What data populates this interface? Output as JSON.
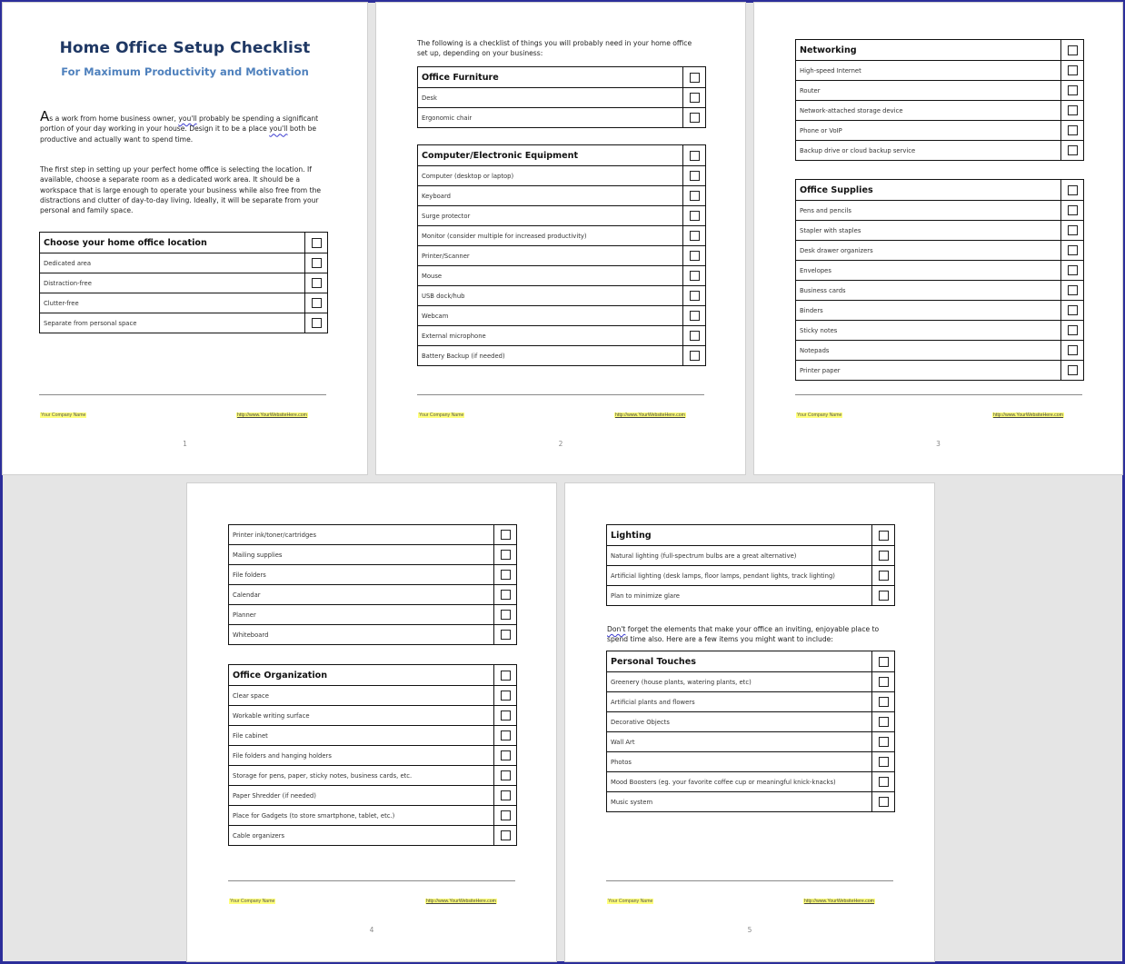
{
  "document": {
    "title": "Home Office Setup Checklist",
    "subtitle": "For Maximum Productivity and Motivation",
    "footer": {
      "company": "Your Company Name",
      "url": "http://www.YourWebsiteHere.com"
    }
  },
  "pages": [
    {
      "number": "1",
      "intro": {
        "dropcap": "A",
        "p1_a": "s a work from home business owner, ",
        "p1_spell1": "you'll",
        "p1_b": " probably be spending a significant portion of your day working in your house. Design it to be a place ",
        "p1_spell2": "you'll",
        "p1_c": " both be productive and actually want to spend time.",
        "p2": "The first step in setting up your perfect home office is selecting the location. If available, choose a separate room as a dedicated work area. It should be a workspace that is large enough to operate your business while also free from the distractions and clutter of day-to-day living. Ideally, it will be separate from your personal and family space."
      },
      "sections": [
        {
          "heading": "Choose your home office location",
          "items": [
            "Dedicated area",
            "Distraction-free",
            "Clutter-free",
            "Separate from personal space"
          ]
        }
      ]
    },
    {
      "number": "2",
      "intro": "The following is a checklist of things you will probably need in your home office set up, depending on your business:",
      "sections": [
        {
          "heading": "Office Furniture",
          "items": [
            "Desk",
            "Ergonomic chair"
          ]
        },
        {
          "heading": "Computer/Electronic Equipment",
          "items": [
            "Computer (desktop or laptop)",
            "Keyboard",
            "Surge protector",
            "Monitor (consider multiple for increased productivity)",
            "Printer/Scanner",
            "Mouse",
            "USB dock/hub",
            "Webcam",
            "External microphone",
            "Battery Backup (if needed)"
          ]
        }
      ]
    },
    {
      "number": "3",
      "sections": [
        {
          "heading": "Networking",
          "items": [
            "High-speed Internet",
            "Router",
            "Network-attached storage device",
            "Phone or VoIP",
            "Backup drive or cloud backup service"
          ]
        },
        {
          "heading": "Office Supplies",
          "items": [
            "Pens and pencils",
            "Stapler with staples",
            "Desk drawer organizers",
            "Envelopes",
            "Business cards",
            "Binders",
            "Sticky notes",
            "Notepads",
            "Printer paper"
          ]
        }
      ]
    },
    {
      "number": "4",
      "sections": [
        {
          "heading": "",
          "items": [
            "Printer ink/toner/cartridges",
            "Mailing supplies",
            "File folders",
            "Calendar",
            "Planner",
            "Whiteboard"
          ]
        },
        {
          "heading": "Office Organization",
          "items": [
            "Clear space",
            "Workable writing surface",
            "File cabinet",
            "File folders and hanging holders",
            "Storage for pens, paper, sticky notes, business cards, etc.",
            "Paper Shredder (if needed)",
            "Place for Gadgets (to store smartphone, tablet, etc.)",
            "Cable organizers"
          ]
        }
      ]
    },
    {
      "number": "5",
      "intro_spell": "Don't",
      "intro": " forget the elements that make your office an inviting, enjoyable place to spend time also. Here are a few items you might want to include:",
      "sections": [
        {
          "heading": "Lighting",
          "items": [
            "Natural lighting (full-spectrum bulbs are a great alternative)",
            "Artificial lighting (desk lamps, floor lamps, pendant lights, track lighting)",
            "Plan to minimize glare"
          ]
        },
        {
          "heading": "Personal Touches",
          "items": [
            "Greenery (house plants, watering plants, etc)",
            "Artificial plants and flowers",
            "Decorative Objects",
            "Wall Art",
            "Photos",
            "Mood Boosters (eg. your favorite coffee cup or meaningful knick-knacks)",
            "Music system"
          ]
        }
      ]
    }
  ]
}
